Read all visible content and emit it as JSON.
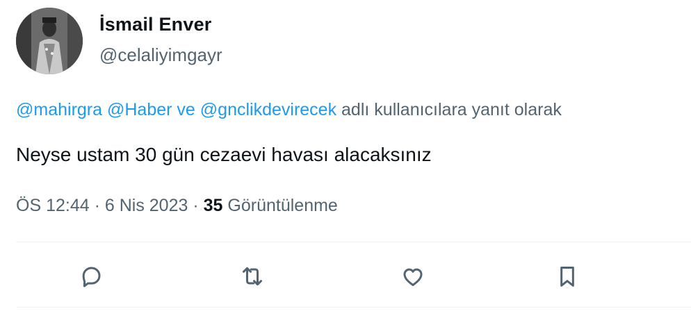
{
  "user": {
    "display_name": "İsmail Enver",
    "handle": "@celaliyimgayr"
  },
  "reply_context": {
    "mention_1": "@mahirgra",
    "mention_2": "@Haber",
    "connector": "ve",
    "mention_3": "@gnclikdevirecek",
    "suffix": "adlı kullanıcılara yanıt olarak"
  },
  "tweet": {
    "text": "Neyse ustam 30 gün cezaevi havası alacaksınız"
  },
  "meta": {
    "time": "ÖS 12:44",
    "date": "6 Nis 2023",
    "views_count": "35",
    "views_label": "Görüntülenme"
  },
  "actions": {
    "icons": [
      "reply-icon",
      "retweet-icon",
      "like-icon",
      "bookmark-icon"
    ],
    "icon_color": "#536471"
  },
  "colors": {
    "link": "#1d9bf0",
    "secondary_text": "#536471",
    "primary_text": "#0f1419",
    "divider": "#eff3f4"
  }
}
